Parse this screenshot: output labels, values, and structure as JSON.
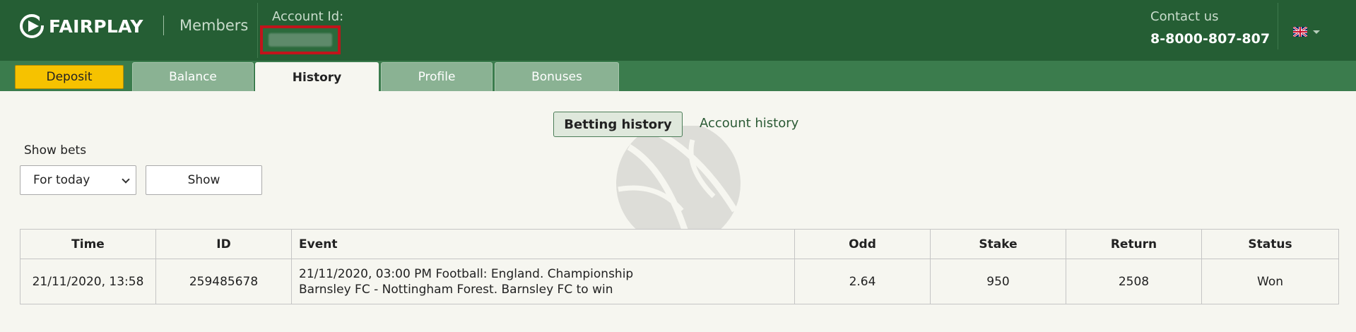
{
  "header": {
    "logo_text": "FAIRPLAY",
    "section": "Members",
    "account_label": "Account Id:",
    "contact_label": "Contact us",
    "contact_phone": "8-8000-807-807",
    "language_icon": "uk-flag-icon"
  },
  "tabs": {
    "deposit": "Deposit",
    "items": [
      {
        "label": "Balance"
      },
      {
        "label": "History",
        "active": true
      },
      {
        "label": "Profile"
      },
      {
        "label": "Bonuses"
      }
    ]
  },
  "subtabs": {
    "betting": "Betting history",
    "account": "Account history"
  },
  "filters": {
    "label": "Show bets",
    "period_value": "For today",
    "show_button": "Show"
  },
  "table": {
    "headers": {
      "time": "Time",
      "id": "ID",
      "event": "Event",
      "odd": "Odd",
      "stake": "Stake",
      "return": "Return",
      "status": "Status"
    },
    "rows": [
      {
        "time": "21/11/2020, 13:58",
        "id": "259485678",
        "event_line1": "21/11/2020, 03:00 PM Football: England. Championship",
        "event_line2": "Barnsley FC - Nottingham Forest. Barnsley FC to win",
        "odd": "2.64",
        "stake": "950",
        "return": "2508",
        "status": "Won"
      }
    ]
  },
  "colors": {
    "header_bg": "#255e34",
    "tabbar_bg": "#3b7c4d",
    "deposit": "#f6c200",
    "won": "#2a6fc9",
    "account_highlight": "#c0141b"
  }
}
